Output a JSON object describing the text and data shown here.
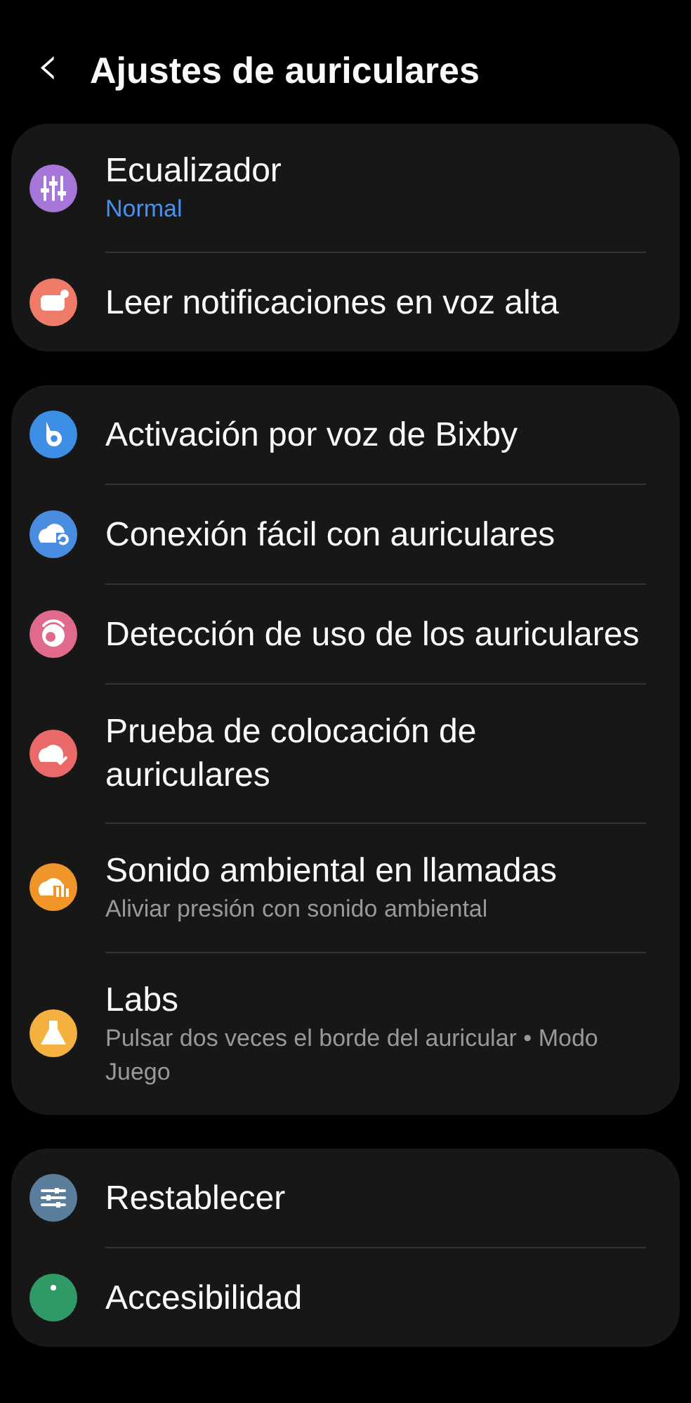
{
  "header": {
    "back": "‹",
    "title": "Ajustes de auriculares"
  },
  "groups": [
    {
      "items": [
        {
          "title": "Ecualizador",
          "color": "#a676d9",
          "subtitle": {
            "text": "Normal",
            "kind": "value"
          }
        },
        {
          "title": "Leer notificaciones en voz alta",
          "color": "#ef7b69"
        }
      ]
    },
    {
      "items": [
        {
          "title": "Activación por voz de Bixby",
          "color": "#3d8fe6"
        },
        {
          "title": "Conexión fácil con auriculares",
          "color": "#4a8de0"
        },
        {
          "title": "Detección de uso de los auriculares",
          "color": "#df6a8b"
        },
        {
          "title": "Prueba de colocación de auriculares",
          "color": "#ea6a6a"
        },
        {
          "title": "Sonido ambiental en llamadas",
          "color": "#f0952a",
          "subtitle": {
            "text": "Aliviar presión con sonido ambiental",
            "kind": "description"
          }
        },
        {
          "title": "Labs",
          "color": "#f4b13f",
          "subtitle": {
            "text": "Pulsar dos veces el borde del auricular • Modo Juego",
            "kind": "description"
          }
        }
      ]
    },
    {
      "items": [
        {
          "title": "Restablecer",
          "color": "#5a7e9b"
        },
        {
          "title": "Accesibilidad",
          "color": "#2f9a66"
        }
      ]
    }
  ]
}
